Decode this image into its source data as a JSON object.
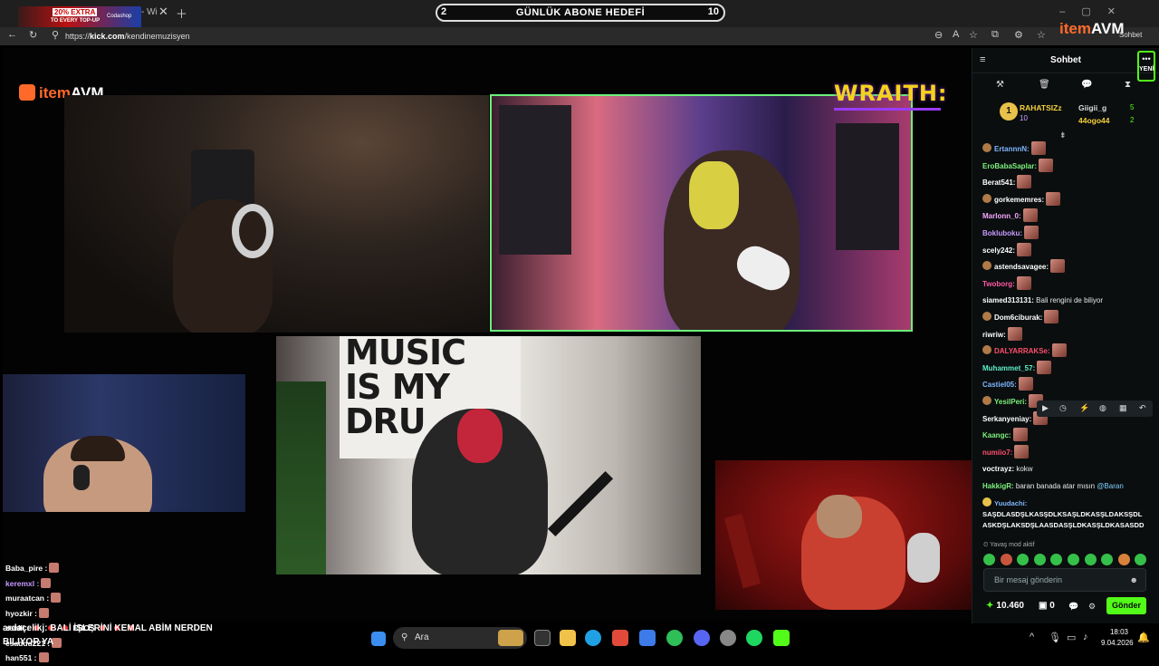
{
  "browser": {
    "tab_title": "- Wi",
    "promo": {
      "line1": "20% EXTRA",
      "line2": "TO EVERY TOP-UP",
      "brand": "Codashop"
    },
    "url_prefix": "https://",
    "url_domain": "kick.com",
    "url_path": "/kendinemuzisyen",
    "goal": {
      "left": "2",
      "title": "GÜNLÜK ABONE HEDEFİ",
      "right": "10",
      "progress": 0.0
    }
  },
  "top_overlay": {
    "brand_a": "item",
    "brand_b": "AVM",
    "sohbet": "Sohbet"
  },
  "stream": {
    "logo_a": "item",
    "logo_b": "AVM",
    "wraith": "WRAITH:",
    "wall_text": [
      "MUSIC",
      "IS MY",
      "DRU"
    ],
    "overlay_chat": [
      {
        "user": "Baba_pire :",
        "color": "#ffffff",
        "content": "emote"
      },
      {
        "user": "keremxl :",
        "color": "#c79bff",
        "content": "emote"
      },
      {
        "user": "muraatcan :",
        "color": "#ffffff",
        "content": "emote"
      },
      {
        "user": "hyozkir :",
        "color": "#ffffff",
        "content": "emote"
      },
      {
        "user": "zenlll :",
        "color": "#ffffff",
        "content": "dots",
        "text": "EBOŞ"
      },
      {
        "user": "esaddd221 :",
        "color": "#ffffff",
        "content": "emote"
      },
      {
        "user": "han551 :",
        "color": "#ffffff",
        "content": "emote"
      }
    ],
    "ticker_user": "ardaçelikj",
    "ticker_text": ": BALİ İŞLERİNİ KEMAL ABİM NERDEN",
    "ticker_line2": "BILIYOR YA"
  },
  "taskbar": {
    "search_placeholder": "Ara",
    "time": "18:03",
    "date": "9.04.2026"
  },
  "chat": {
    "title": "Sohbet",
    "more_label": "YENİ",
    "pinned": {
      "first": {
        "rank": "1",
        "name": "RAHATSIZz",
        "count": "10"
      },
      "second": {
        "name": "Giigii_g",
        "count": "5"
      },
      "third": {
        "name": "44ogo44",
        "count": "2"
      }
    },
    "messages": [
      {
        "user": "ErtannnN:",
        "color": "#7fb6ff",
        "badge": true,
        "emote": true,
        "text": ""
      },
      {
        "user": "EroBabaSaplar:",
        "color": "#7cf07c",
        "badge": false,
        "emote": true,
        "text": ""
      },
      {
        "user": "Berat541:",
        "color": "#ffffff",
        "badge": false,
        "emote": true,
        "text": ""
      },
      {
        "user": "gorkememres:",
        "color": "#ffffff",
        "badge": true,
        "emote": true,
        "text": ""
      },
      {
        "user": "Marlonn_0:",
        "color": "#f5a7ff",
        "badge": false,
        "emote": true,
        "text": ""
      },
      {
        "user": "Bokluboku:",
        "color": "#c79bff",
        "badge": false,
        "emote": true,
        "text": ""
      },
      {
        "user": "scely242:",
        "color": "#ffffff",
        "badge": false,
        "emote": true,
        "text": ""
      },
      {
        "user": "astendsavagee:",
        "color": "#ffffff",
        "badge": true,
        "emote": true,
        "text": ""
      },
      {
        "user": "Twoborg:",
        "color": "#ff5aa5",
        "badge": false,
        "emote": true,
        "text": ""
      },
      {
        "user": "siamed313131:",
        "color": "#ffffff",
        "badge": false,
        "emote": false,
        "text": " Bali rengini de biliyor"
      },
      {
        "user": "Dom6ciburak:",
        "color": "#ffffff",
        "badge": true,
        "emote": true,
        "text": ""
      },
      {
        "user": "riwriw:",
        "color": "#ffffff",
        "badge": false,
        "emote": true,
        "text": ""
      },
      {
        "user": "DALYARRAKSe:",
        "color": "#ff4d6d",
        "badge": true,
        "emote": true,
        "text": ""
      },
      {
        "user": "Muhammet_57:",
        "color": "#5ff0c8",
        "badge": false,
        "emote": true,
        "text": ""
      },
      {
        "user": "Castiel05:",
        "color": "#7fb6ff",
        "badge": false,
        "emote": true,
        "text": ""
      },
      {
        "user": "YesilPeri:",
        "color": "#7cf07c",
        "badge": true,
        "emote": true,
        "text": ""
      },
      {
        "user": "Serkanyeniay:",
        "color": "#ffffff",
        "badge": false,
        "emote": true,
        "text": ""
      },
      {
        "user": "Kaangc:",
        "color": "#7cf07c",
        "badge": false,
        "emote": true,
        "text": ""
      },
      {
        "user": "numiio7:",
        "color": "#ff4d6d",
        "badge": false,
        "emote": true,
        "text": ""
      },
      {
        "user": "voctrayz:",
        "color": "#ffffff",
        "badge": false,
        "emote": false,
        "text": " kokw"
      },
      {
        "user": "HakkigR:",
        "color": "#7cf07c",
        "badge": false,
        "emote": false,
        "text": " baran banada atar mısın ",
        "mention": "@Baran"
      }
    ],
    "long_message": {
      "user": "Yuudachi:",
      "color": "#7fb6ff",
      "text": "SAŞDLASDŞLKASŞDLKSAŞLDKASŞLDAKSŞDL ASKDŞLAKSDŞLAASDASŞLDKASŞLDKASASDD"
    },
    "slow_mode": "Yavaş mod aktif",
    "input_placeholder": "Bir mesaj gönderin",
    "points": "10.460",
    "gift_count": "0",
    "send_label": "Gönder",
    "accent": "#53fc18"
  }
}
